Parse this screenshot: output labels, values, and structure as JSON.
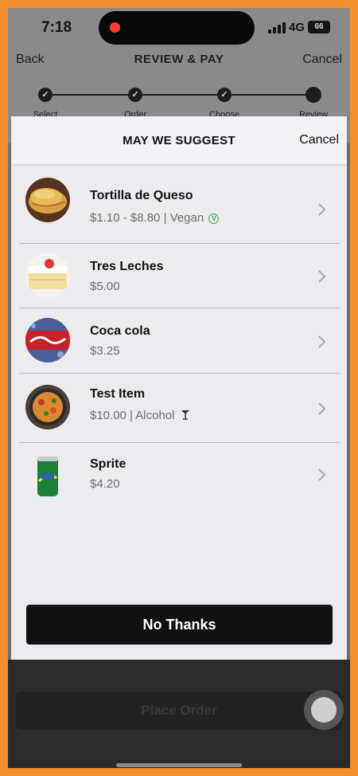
{
  "status_bar": {
    "time": "7:18",
    "network": "4G",
    "battery": "66"
  },
  "nav": {
    "back_label": "Back",
    "title": "REVIEW & PAY",
    "cancel_label": "Cancel"
  },
  "stepper": {
    "steps": [
      {
        "label": "Select"
      },
      {
        "label": "Order"
      },
      {
        "label": "Choose"
      },
      {
        "label": "Review"
      }
    ]
  },
  "suggest_sheet": {
    "title": "MAY WE SUGGEST",
    "cancel_label": "Cancel",
    "items": [
      {
        "name": "Tortilla de Queso",
        "price": "$1.10 - $8.80 | Vegan",
        "badge": "vegan-icon",
        "thumb": "tortilla-image"
      },
      {
        "name": "Tres Leches",
        "price": "$5.00",
        "thumb": "cake-image"
      },
      {
        "name": "Coca cola",
        "price": "$3.25",
        "thumb": "coca-cola-image"
      },
      {
        "name": "Test Item",
        "price": "$10.00 | Alcohol",
        "badge": "cocktail-icon",
        "thumb": "paella-image"
      },
      {
        "name": "Sprite",
        "price": "$4.20",
        "thumb": "sprite-can-image"
      }
    ],
    "no_thanks_label": "No Thanks"
  },
  "footer": {
    "place_order_label": "Place Order"
  },
  "colors": {
    "background_frame": "#F4902F",
    "button_dark": "#111111",
    "vegan_green": "#3aa55a"
  }
}
